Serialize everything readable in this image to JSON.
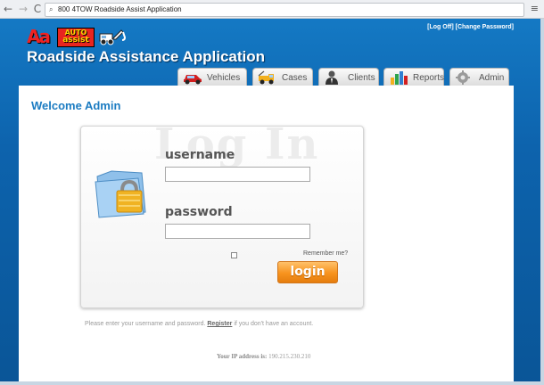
{
  "browser": {
    "back_glyph": "←",
    "forward_glyph": "→",
    "reload_glyph": "C",
    "address": "800 4TOW Roadside Assist Application",
    "menu_glyph": "≡"
  },
  "header": {
    "logo_aa": "Aa",
    "logo_auto": "AUTO",
    "logo_assist": "assist",
    "title": "Roadside Assistance Application",
    "log_off": "[Log Off]",
    "change_password": "[Change Password]"
  },
  "tabs": [
    {
      "label": "Vehicles",
      "icon": "car-icon"
    },
    {
      "label": "Cases",
      "icon": "tow-truck-icon"
    },
    {
      "label": "Clients",
      "icon": "person-icon"
    },
    {
      "label": "Reports",
      "icon": "bar-chart-icon"
    },
    {
      "label": "Admin",
      "icon": "gear-icon"
    }
  ],
  "main": {
    "welcome": "Welcome Admin",
    "watermark": "Log In",
    "username_label": "username",
    "username_value": "",
    "password_label": "password",
    "password_value": "",
    "remember_label": "Remember me?",
    "remember_checked": false,
    "login_label": "login",
    "help_prefix": "Please enter your username and password.",
    "register_link": "Register",
    "help_suffix": "if you don't have an account.",
    "ip_label": "Your IP address is:",
    "ip_value": "190.215.230.210"
  },
  "colors": {
    "brand_blue": "#0d63ad",
    "accent_orange": "#f7931e",
    "welcome_blue": "#1c7cc2"
  }
}
